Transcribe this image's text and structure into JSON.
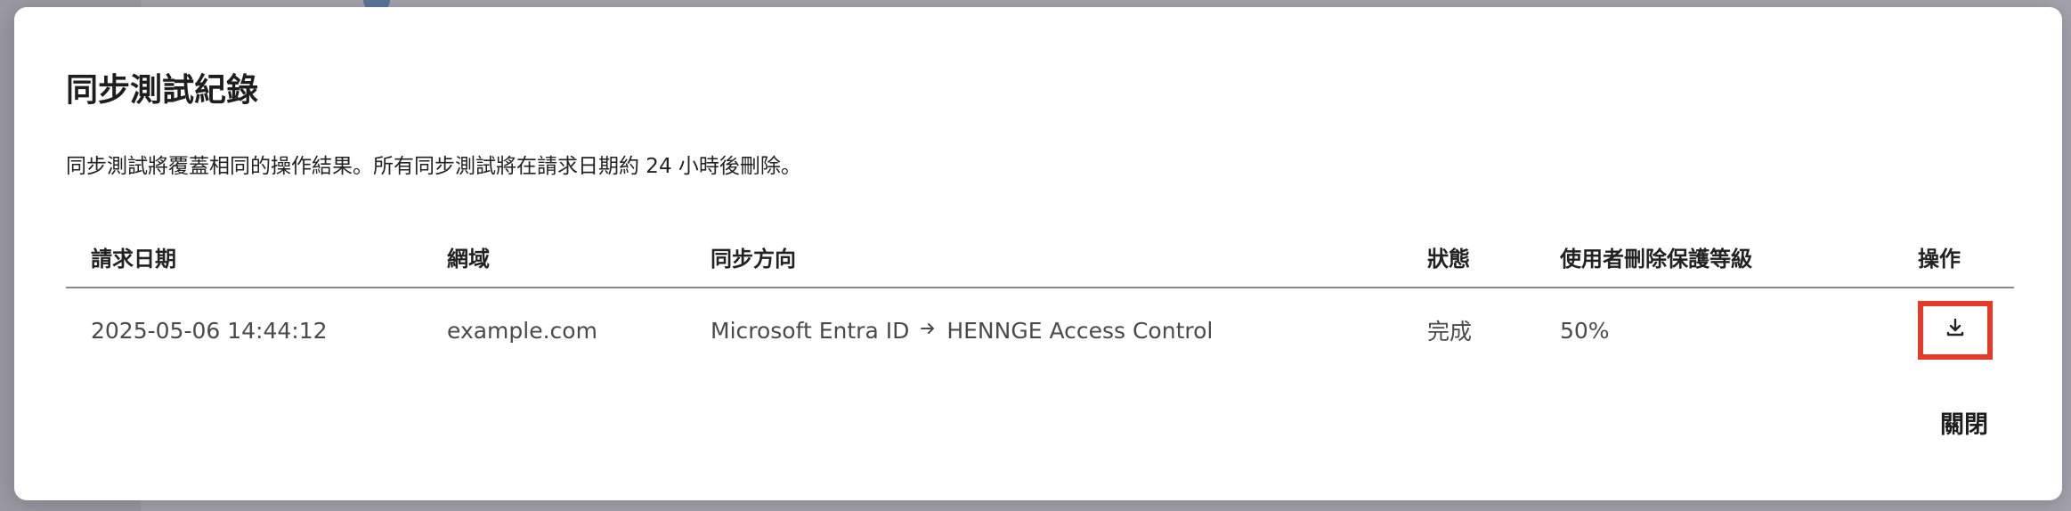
{
  "modal": {
    "title": "同步測試紀錄",
    "description": "同步測試將覆蓋相同的操作結果。所有同步測試將在請求日期約 24 小時後刪除。",
    "close_label": "關閉"
  },
  "table": {
    "headers": {
      "date": "請求日期",
      "domain": "網域",
      "direction": "同步方向",
      "status": "狀態",
      "level": "使用者刪除保護等級",
      "ops": "操作"
    },
    "rows": [
      {
        "date": "2025-05-06 14:44:12",
        "domain": "example.com",
        "direction_from": "Microsoft Entra ID",
        "direction_to": "HENNGE Access Control",
        "status": "完成",
        "level": "50%"
      }
    ]
  },
  "icons": {
    "download": "download-icon",
    "arrow": "arrow-right-icon"
  },
  "colors": {
    "highlight": "#e43b2a",
    "overlay": "#8f8d96"
  }
}
